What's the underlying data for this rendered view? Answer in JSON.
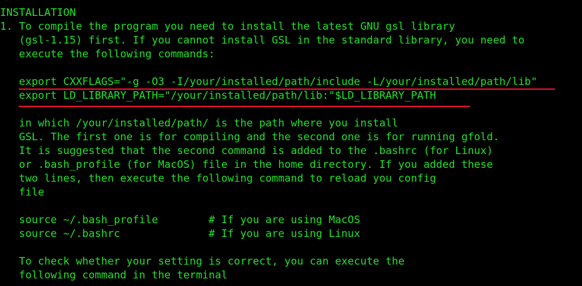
{
  "theme": {
    "background": "#000000",
    "text_color": "#22e12a",
    "underline_color": "#e0102a"
  },
  "terminal": {
    "lines": [
      "INSTALLATION",
      "1. To compile the program you need to install the latest GNU gsl library",
      "   (gsl-1.15) first. If you cannot install GSL in the standard library, you need to",
      "   execute the following commands:",
      "",
      "   export CXXFLAGS=\"-g -O3 -I/your/installed/path/include -L/your/installed/path/lib\"",
      "   export LD_LIBRARY_PATH=\"/your/installed/path/lib:\"$LD_LIBRARY_PATH",
      "",
      "   in which /your/installed/path/ is the path where you install",
      "   GSL. The first one is for compiling and the second one is for running gfold.",
      "   It is suggested that the second command is added to the .bashrc (for Linux)",
      "   or .bash_profile (for MacOS) file in the home directory. If you added these",
      "   two lines, then execute the following command to reload you config",
      "   file",
      "",
      "   source ~/.bash_profile        # If you are using MacOS",
      "   source ~/.bashrc              # If you are using Linux",
      "",
      "   To check whether your setting is correct, you can execute the",
      "   following command in the terminal"
    ]
  }
}
